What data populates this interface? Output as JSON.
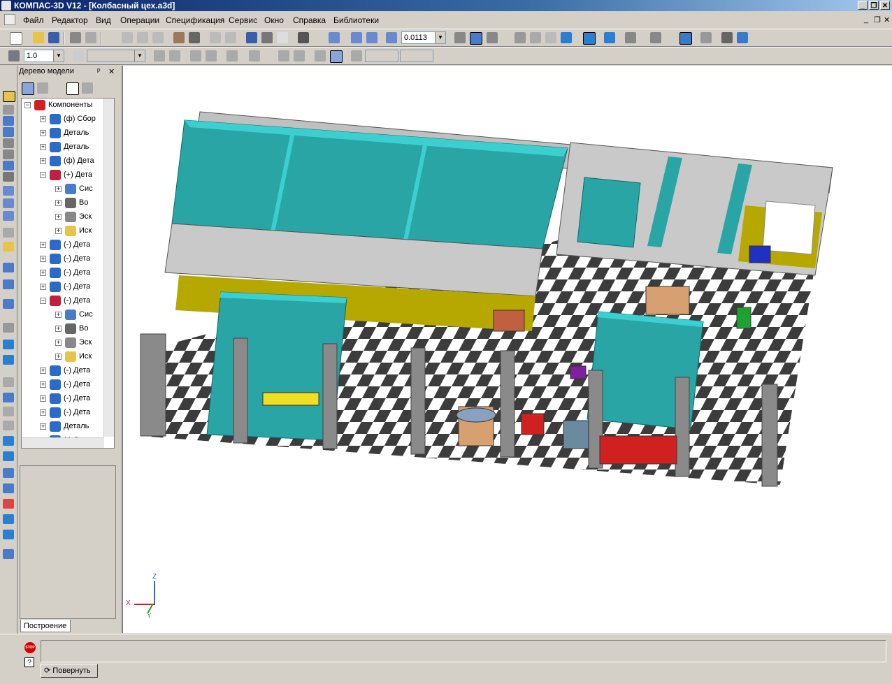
{
  "window": {
    "title": "КОМПАС-3D V12 - [Колбасный цех.a3d]",
    "minimize": "_",
    "restore": "❐",
    "close": "✕"
  },
  "menu": {
    "items": [
      "Файл",
      "Редактор",
      "Вид",
      "Операции",
      "Спецификация",
      "Сервис",
      "Окно",
      "Справка",
      "Библиотеки"
    ]
  },
  "mdi": {
    "minimize": "_",
    "restore": "❐",
    "close": "✕"
  },
  "toolbar1": {
    "zoom_value": "0.0113"
  },
  "toolbar2": {
    "step_value": "1.0"
  },
  "panel": {
    "title": "Дерево модели",
    "pin": "ᵖ",
    "close": "✕",
    "tab_label": "Построение"
  },
  "tree": [
    {
      "label": "Компоненты",
      "level": 0,
      "expander": "−",
      "icon": "root"
    },
    {
      "label": "(ф) Сбор",
      "level": 1,
      "expander": "+",
      "icon": "part"
    },
    {
      "label": "Деталь",
      "level": 1,
      "expander": "+",
      "icon": "part"
    },
    {
      "label": "Деталь",
      "level": 1,
      "expander": "+",
      "icon": "part"
    },
    {
      "label": "(ф) Дета",
      "level": 1,
      "expander": "+",
      "icon": "part"
    },
    {
      "label": "(+) Дета",
      "level": 1,
      "expander": "−",
      "icon": "part-red"
    },
    {
      "label": "Сис",
      "level": 2,
      "expander": "+",
      "icon": "cs"
    },
    {
      "label": "Во",
      "level": 2,
      "expander": "+",
      "icon": "hand"
    },
    {
      "label": "Эск",
      "level": 2,
      "expander": "+",
      "icon": "sketch"
    },
    {
      "label": "Иск",
      "level": 2,
      "expander": "+",
      "icon": "xo"
    },
    {
      "label": "(-) Дета",
      "level": 1,
      "expander": "+",
      "icon": "part"
    },
    {
      "label": "(-) Дета",
      "level": 1,
      "expander": "+",
      "icon": "part"
    },
    {
      "label": "(-) Дета",
      "level": 1,
      "expander": "+",
      "icon": "part"
    },
    {
      "label": "(-) Дета",
      "level": 1,
      "expander": "+",
      "icon": "part"
    },
    {
      "label": "(-) Дета",
      "level": 1,
      "expander": "−",
      "icon": "part-red"
    },
    {
      "label": "Сис",
      "level": 2,
      "expander": "+",
      "icon": "cs"
    },
    {
      "label": "Во",
      "level": 2,
      "expander": "+",
      "icon": "hand"
    },
    {
      "label": "Эск",
      "level": 2,
      "expander": "+",
      "icon": "sketch"
    },
    {
      "label": "Иск",
      "level": 2,
      "expander": "+",
      "icon": "xo"
    },
    {
      "label": "(-) Дета",
      "level": 1,
      "expander": "+",
      "icon": "part"
    },
    {
      "label": "(-) Дета",
      "level": 1,
      "expander": "+",
      "icon": "part"
    },
    {
      "label": "(-) Дета",
      "level": 1,
      "expander": "+",
      "icon": "part"
    },
    {
      "label": "(-) Дета",
      "level": 1,
      "expander": "+",
      "icon": "part"
    },
    {
      "label": "Деталь",
      "level": 1,
      "expander": "+",
      "icon": "part"
    },
    {
      "label": "(-) Дета",
      "level": 1,
      "expander": "+",
      "icon": "part"
    }
  ],
  "axes": {
    "x": "X",
    "y": "Y",
    "z": "Z"
  },
  "status": {
    "stop_icon": "STOP",
    "help_icon": "?",
    "rotate_label": "Повернуть"
  },
  "colors": {
    "accent": "#0a246a",
    "wall_teal": "#2aa5a5",
    "wall_top": "#3ccfd0",
    "floor_dark": "#3a3a3a",
    "wall_yellow": "#b7a800",
    "wall_grey": "#c8c8c8"
  }
}
